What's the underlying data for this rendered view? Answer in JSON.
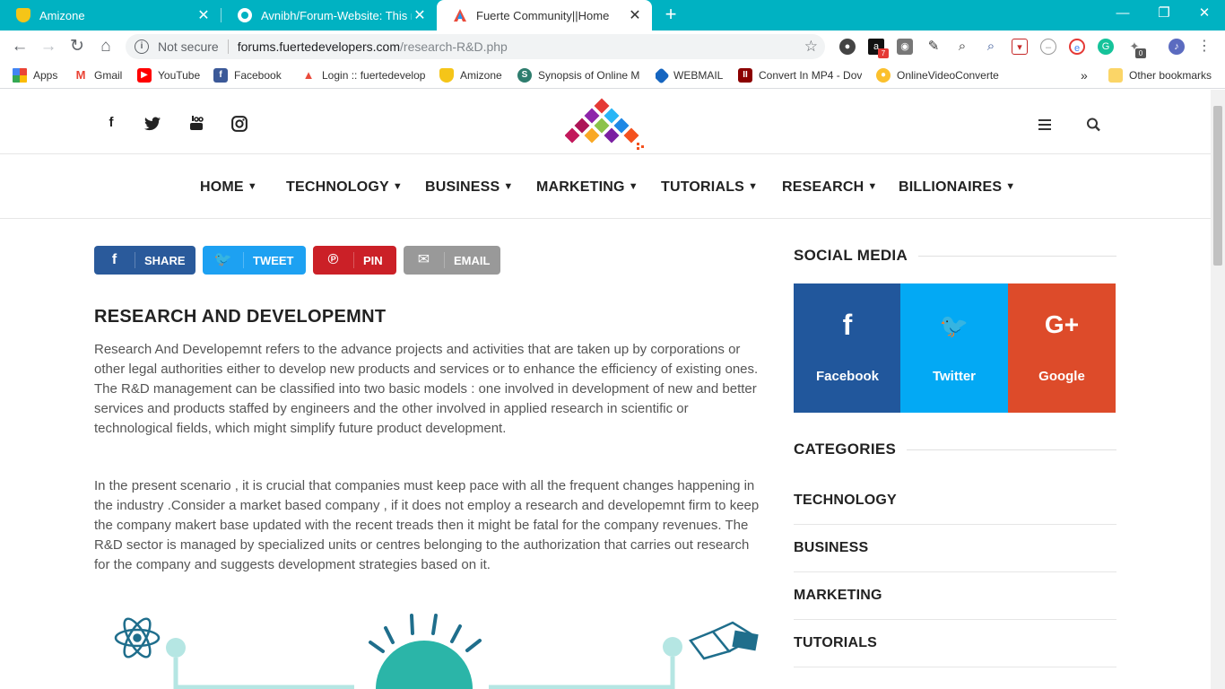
{
  "browser": {
    "tabs": [
      {
        "title": "Amizone",
        "active": false
      },
      {
        "title": "Avnibh/Forum-Website: This repo",
        "active": false
      },
      {
        "title": "Fuerte Community||Home",
        "active": true
      }
    ],
    "new_tab_label": "+",
    "omnibox": {
      "security_label": "Not secure",
      "url_host": "forums.fuertedevelopers.com",
      "url_path": "/research-R&D.php"
    },
    "extension_badges": {
      "amazon": "7",
      "counter": "0"
    },
    "bookmarks": [
      {
        "label": "Apps",
        "icon": "apps-grid-icon"
      },
      {
        "label": "Gmail",
        "icon": "gmail-icon"
      },
      {
        "label": "YouTube",
        "icon": "youtube-icon"
      },
      {
        "label": "Facebook",
        "icon": "facebook-icon"
      },
      {
        "label": "Login :: fuertedevelop",
        "icon": "fuerte-icon"
      },
      {
        "label": "Amizone",
        "icon": "amizone-icon"
      },
      {
        "label": "Synopsis of Online M",
        "icon": "synopsis-icon"
      },
      {
        "label": "WEBMAIL",
        "icon": "webmail-icon"
      },
      {
        "label": "Convert In MP4 - Dov",
        "icon": "convert-icon"
      },
      {
        "label": "OnlineVideoConverte",
        "icon": "video-converter-icon"
      }
    ],
    "bookmarks_overflow": "»",
    "other_bookmarks": "Other bookmarks"
  },
  "site": {
    "nav": [
      {
        "label": "HOME"
      },
      {
        "label": "TECHNOLOGY"
      },
      {
        "label": "BUSINESS"
      },
      {
        "label": "MARKETING"
      },
      {
        "label": "TUTORIALS"
      },
      {
        "label": "RESEARCH"
      },
      {
        "label": "BILLIONAIRES"
      }
    ],
    "share_buttons": [
      {
        "label": "SHARE",
        "color": "#2a5a9b"
      },
      {
        "label": "TWEET",
        "color": "#1da1f2"
      },
      {
        "label": "PIN",
        "color": "#cb2027"
      },
      {
        "label": "EMAIL",
        "color": "#999999"
      }
    ],
    "article": {
      "title": "RESEARCH AND DEVELOPEMNT",
      "paragraphs": [
        "Research And Developemnt refers to the advance projects and activities that are taken up by corporations or other legal authorities either to develop new products and services or to enhance the efficiency of existing ones. The R&D management can be classified into two basic models : one involved in development of new and better services and products staffed by engineers and the other involved in applied research in scientific or technological fields, which might simplify future product development.",
        "In the present scenario , it is crucial that companies must keep pace with all the frequent changes happening in the industry .Consider a market based company , if it does not employ a research and developemnt firm to keep the company makert base updated with the recent treads then it might be fatal for the company revenues. The R&D sector is managed by specialized units or centres belonging to the authorization that carries out research for the company and suggests development strategies based on it."
      ]
    },
    "sidebar": {
      "social_heading": "SOCIAL MEDIA",
      "social": [
        {
          "name": "Facebook",
          "glyph": "f",
          "color": "#21579c"
        },
        {
          "name": "Twitter",
          "glyph": "🐦",
          "color": "#03a9f4"
        },
        {
          "name": "Google",
          "glyph": "G+",
          "color": "#dd4b2a"
        }
      ],
      "categories_heading": "CATEGORIES",
      "categories": [
        "TECHNOLOGY",
        "BUSINESS",
        "MARKETING",
        "TUTORIALS"
      ]
    }
  }
}
